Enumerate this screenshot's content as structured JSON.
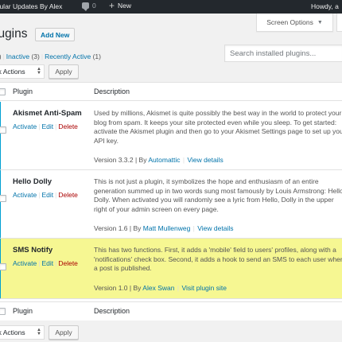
{
  "adminbar": {
    "site_name": "egular Updates By Alex",
    "comments_count": "0",
    "new_label": "New",
    "howdy": "Howdy, a"
  },
  "screen_options": {
    "label": "Screen Options",
    "arrow": "▼"
  },
  "page": {
    "title": "lugins",
    "add_new": "Add New"
  },
  "filters": {
    "all_count_fragment": "3)",
    "inactive_label": "Inactive",
    "inactive_count": "(3)",
    "recent_label": "Recently Active",
    "recent_count": "(1)"
  },
  "search": {
    "placeholder": "Search installed plugins..."
  },
  "bulk": {
    "label": "ulk Actions",
    "apply": "Apply"
  },
  "table": {
    "col_plugin": "Plugin",
    "col_description": "Description",
    "rows": [
      {
        "name": "Akismet Anti-Spam",
        "activate": "Activate",
        "edit": "Edit",
        "delete": "Delete",
        "description": "Used by millions, Akismet is quite possibly the best way in the world to protect your blog from spam. It keeps your site protected even while you sleep. To get started: activate the Akismet plugin and then go to your Akismet Settings page to set up your API key.",
        "version": "Version 3.3.2 | By",
        "author": "Automattic",
        "details": "View details"
      },
      {
        "name": "Hello Dolly",
        "activate": "Activate",
        "edit": "Edit",
        "delete": "Delete",
        "description": "This is not just a plugin, it symbolizes the hope and enthusiasm of an entire generation summed up in two words sung most famously by Louis Armstrong: Hello, Dolly. When activated you will randomly see a lyric from Hello, Dolly in the upper right of your admin screen on every page.",
        "version": "Version 1.6 | By",
        "author": "Matt Mullenweg",
        "details": "View details"
      },
      {
        "name": "SMS Notify",
        "activate": "Activate",
        "edit": "Edit",
        "delete": "Delete",
        "description": "This has two functions. First, it adds a 'mobile' field to users' profiles, along with a 'notifications' check box. Second, it adds a hook to send an SMS to each user when a post is published.",
        "version": "Version 1.0 | By",
        "author": "Alex Swan",
        "details": "Visit plugin site"
      }
    ]
  },
  "colors": {
    "link": "#0073aa",
    "delete": "#aa0000",
    "highlight_row": "#f6f792",
    "adminbar": "#23282d"
  }
}
